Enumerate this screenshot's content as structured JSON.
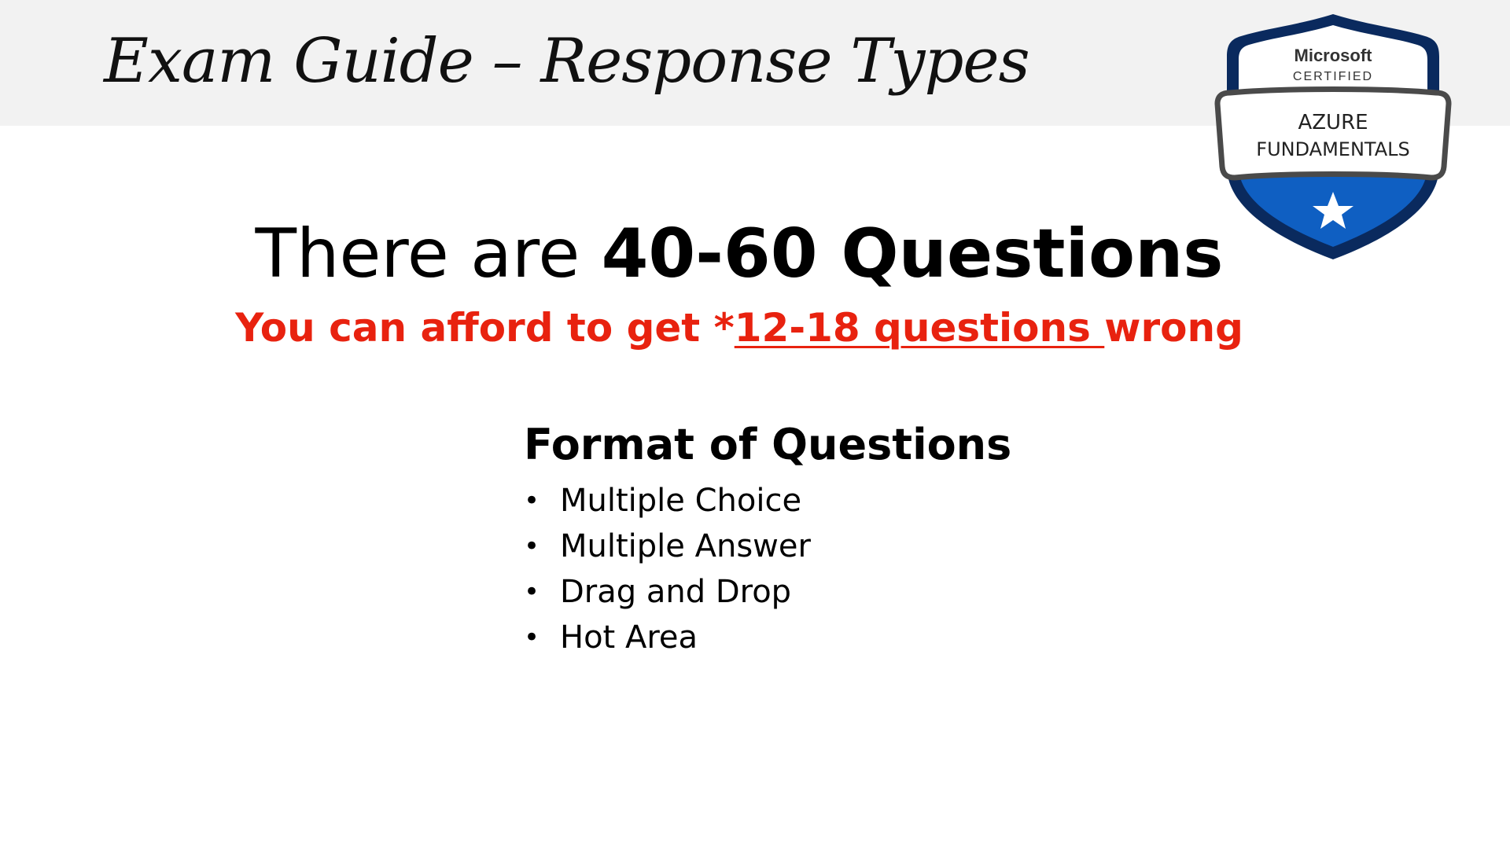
{
  "slide": {
    "title": "Exam Guide – Response Types"
  },
  "badge": {
    "brand": "Microsoft",
    "certified": "CERTIFIED",
    "line1": "AZURE",
    "line2": "FUNDAMENTALS",
    "icon": "star-icon",
    "colors": {
      "shield_dark": "#0a2a5e",
      "shield_blue": "#0f5fc2",
      "ribbon_border": "#4a4a4a"
    }
  },
  "headline": {
    "lead": "There are ",
    "strong": "40-60 Questions"
  },
  "subheadline": {
    "lead": "You can afford to get *",
    "underlined": "12-18 questions ",
    "tail": "wrong",
    "color": "#e8220f"
  },
  "format": {
    "heading": "Format of Questions",
    "items": [
      "Multiple Choice",
      "Multiple Answer",
      "Drag and Drop",
      "Hot Area"
    ]
  }
}
